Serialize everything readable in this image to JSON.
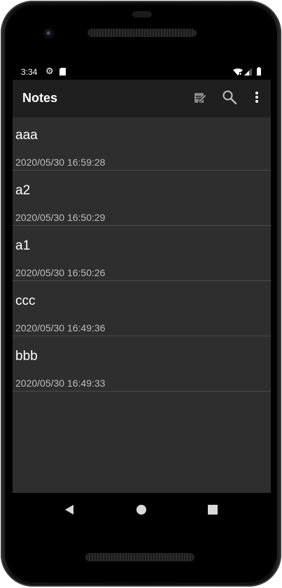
{
  "status_bar": {
    "time": "3:34",
    "icons": [
      "gear-icon",
      "sd-card-icon",
      "wifi-icon",
      "signal-icon",
      "battery-icon"
    ]
  },
  "app_bar": {
    "title": "Notes",
    "actions": [
      "edit-note-icon",
      "search-icon",
      "more-vert-icon"
    ]
  },
  "notes": [
    {
      "title": "aaa",
      "date": "2020/05/30 16:59:28"
    },
    {
      "title": "a2",
      "date": "2020/05/30 16:50:29"
    },
    {
      "title": "a1",
      "date": "2020/05/30 16:50:26"
    },
    {
      "title": "ccc",
      "date": "2020/05/30 16:49:36"
    },
    {
      "title": "bbb",
      "date": "2020/05/30 16:49:33"
    }
  ],
  "nav_bar": {
    "buttons": [
      "back-icon",
      "home-icon",
      "recents-icon"
    ]
  },
  "colors": {
    "app_bar_bg": "#1f1f1f",
    "list_bg": "#2e2e2e",
    "divider": "#4a4a4a",
    "title_text": "#ffffff",
    "date_text": "#bdbdbd",
    "system_bar_bg": "#000000"
  }
}
